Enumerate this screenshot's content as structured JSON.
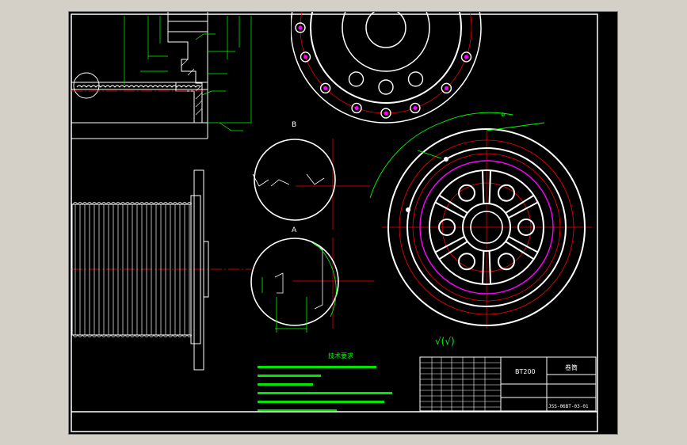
{
  "title_block": {
    "model": "BT200",
    "part_name": "卷筒",
    "drawing_no": "JSS-06BT-03-01"
  },
  "tech_requirements": {
    "heading": "技术要求"
  },
  "surface_finish": {
    "symbol": "√(√)"
  },
  "colors": {
    "background": "#000000",
    "outline": "#ffffff",
    "dimension": "#00ff00",
    "centerline": "#ff0000",
    "bolt_circle": "#ff00ff",
    "hatch": "#ffffff",
    "border": "#ffffff"
  },
  "icons": {
    "section_marker": "circle-section-icon",
    "surface_finish": "roughness-check-icon"
  }
}
